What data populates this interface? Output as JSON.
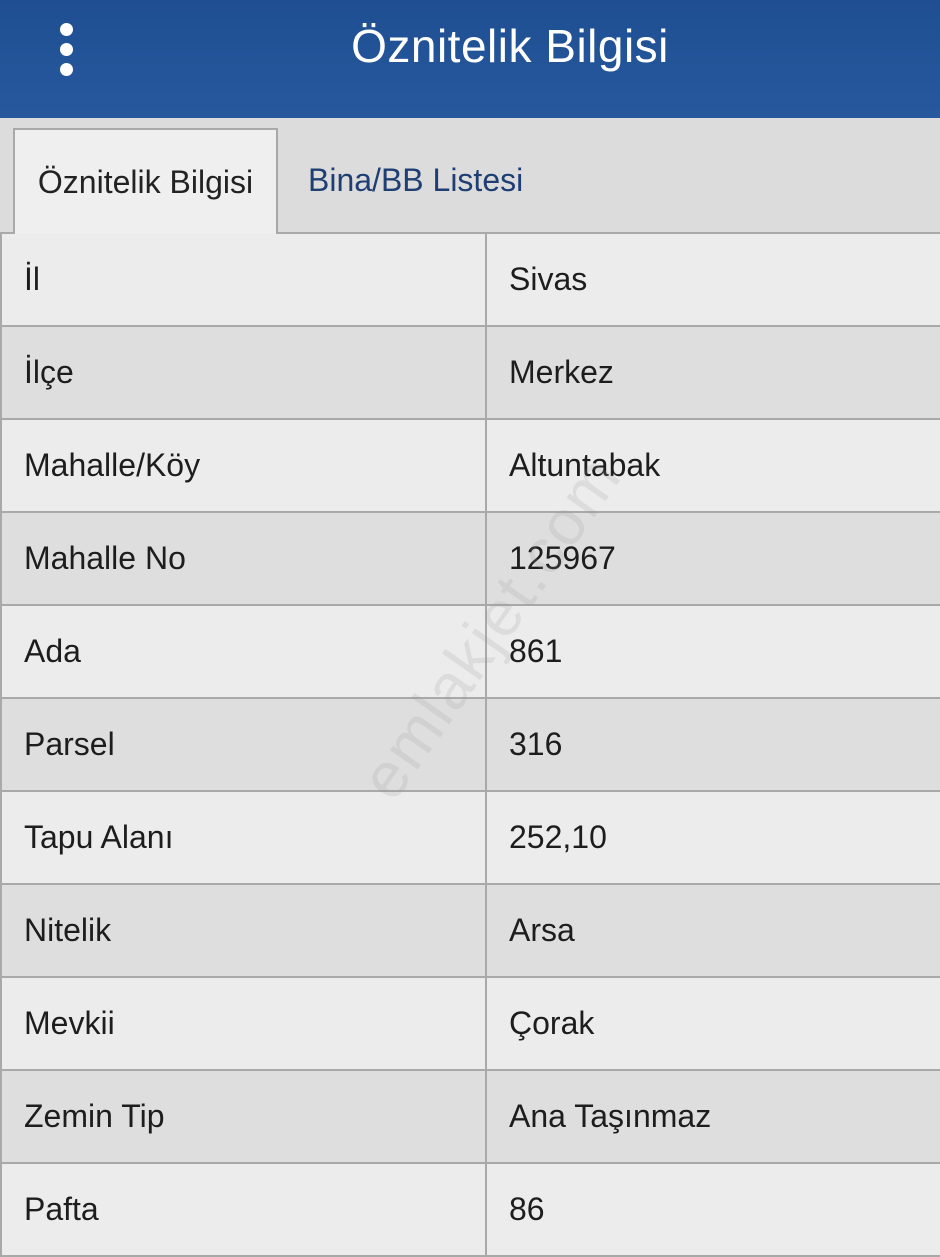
{
  "header": {
    "title": "Öznitelik Bilgisi",
    "menu_icon": "vertical-ellipsis-icon",
    "background_color": "#27589e"
  },
  "tabs": [
    {
      "label": "Öznitelik Bilgisi",
      "active": true
    },
    {
      "label": "Bina/BB Listesi",
      "active": false
    }
  ],
  "rows": [
    {
      "key": "İl",
      "value": "Sivas"
    },
    {
      "key": "İlçe",
      "value": "Merkez"
    },
    {
      "key": "Mahalle/Köy",
      "value": "Altuntabak"
    },
    {
      "key": "Mahalle No",
      "value": "125967"
    },
    {
      "key": "Ada",
      "value": "861"
    },
    {
      "key": "Parsel",
      "value": "316"
    },
    {
      "key": "Tapu Alanı",
      "value": "252,10"
    },
    {
      "key": "Nitelik",
      "value": "Arsa"
    },
    {
      "key": "Mevkii",
      "value": "Çorak"
    },
    {
      "key": "Zemin Tip",
      "value": "Ana Taşınmaz"
    },
    {
      "key": "Pafta",
      "value": "86"
    }
  ],
  "watermark": "emlakjet.com"
}
